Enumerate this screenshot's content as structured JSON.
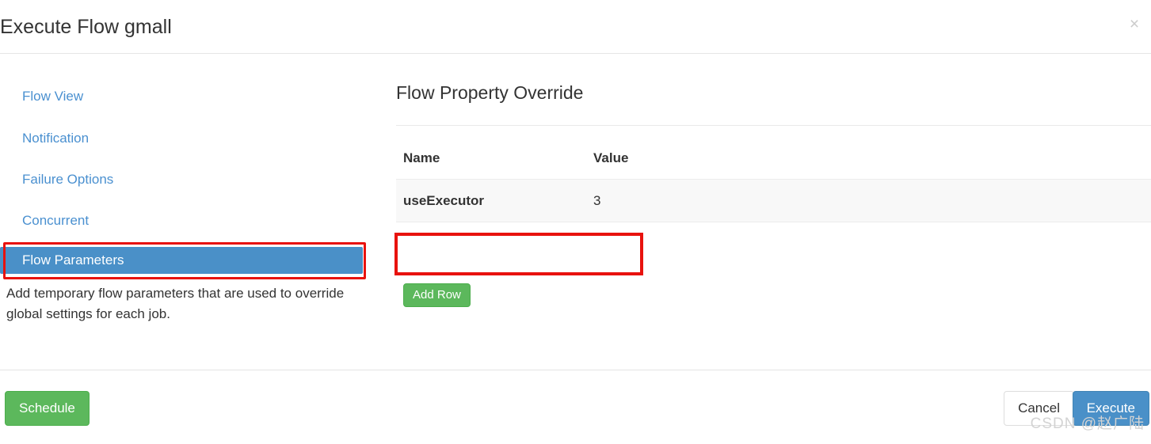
{
  "dialog": {
    "title": "Execute Flow gmall",
    "close_icon": "close-icon",
    "close_glyph": "×"
  },
  "sidebar": {
    "items": [
      {
        "label": "Flow View",
        "active": false
      },
      {
        "label": "Notification",
        "active": false
      },
      {
        "label": "Failure Options",
        "active": false
      },
      {
        "label": "Concurrent",
        "active": false
      },
      {
        "label": "Flow Parameters",
        "active": true
      }
    ],
    "description": "Add temporary flow parameters that are used to override global settings for each job."
  },
  "main": {
    "heading": "Flow Property Override",
    "table": {
      "columns": [
        "Name",
        "Value"
      ],
      "rows": [
        {
          "name": "useExecutor",
          "value": "3"
        }
      ]
    },
    "add_row_label": "Add Row"
  },
  "footer": {
    "schedule_label": "Schedule",
    "cancel_label": "Cancel",
    "execute_label": "Execute"
  },
  "watermark": {
    "text": "CSDN @赵广陆"
  },
  "colors": {
    "link_blue": "#4a90d0",
    "active_blue": "#4a90c8",
    "primary_button": "#4a90c8",
    "success_green": "#5cb85c",
    "annotation_red": "#e8120e",
    "row_background": "#f8f8f8",
    "border_gray": "#e5e5e5",
    "text": "#333333",
    "watermark_gray": "#d3d3d3"
  }
}
